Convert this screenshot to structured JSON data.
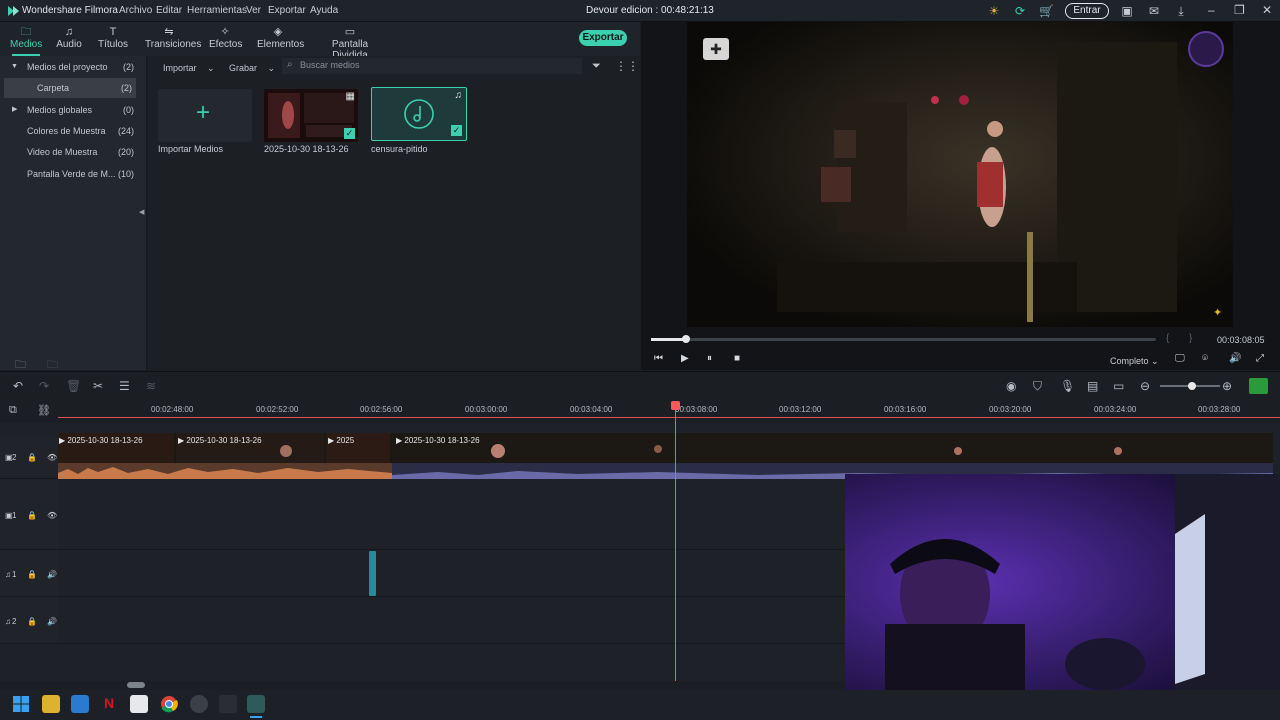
{
  "app": {
    "name": "Wondershare Filmora",
    "project_title": "Devour edicion : 00:48:21:13",
    "login_label": "Entrar",
    "accent": "#3bd0b0"
  },
  "menu": [
    "Archivo",
    "Editar",
    "Herramientas",
    "Ver",
    "Exportar",
    "Ayuda"
  ],
  "media_tabs": [
    "Medios",
    "Audio",
    "Títulos",
    "Transiciones",
    "Efectos",
    "Elementos",
    "Pantalla Dividida"
  ],
  "export_label": "Exportar",
  "sidebar": [
    {
      "label": "Medios del proyecto",
      "count": "(2)"
    },
    {
      "label": "Carpeta",
      "count": "(2)"
    },
    {
      "label": "Medios globales",
      "count": "(0)"
    },
    {
      "label": "Colores de Muestra",
      "count": "(24)"
    },
    {
      "label": "Video de Muestra",
      "count": "(20)"
    },
    {
      "label": "Pantalla Verde de M...",
      "count": "(10)"
    }
  ],
  "media_toolbar": {
    "import": "Importar",
    "record": "Grabar",
    "search_placeholder": "Buscar medios"
  },
  "media_items": [
    "Importar Medios",
    "2025-10-30 18-13-26",
    "censura-pitido"
  ],
  "preview": {
    "timecode": "00:03:08:05",
    "quality": "Completo",
    "progress": 0.07
  },
  "ruler": [
    "00:02:48:00",
    "00:02:52:00",
    "00:02:56:00",
    "00:03:00:00",
    "00:03:04:00",
    "00:03:08:00",
    "00:03:12:00",
    "00:03:16:00",
    "00:03:20:00",
    "00:03:24:00",
    "00:03:28:00"
  ],
  "clips": [
    "2025-10-30 18-13-26",
    "2025-10-30 18-13-26",
    "2025",
    "2025-10-30 18-13-26"
  ],
  "tracks": [
    "2",
    "1",
    "1",
    "2"
  ]
}
